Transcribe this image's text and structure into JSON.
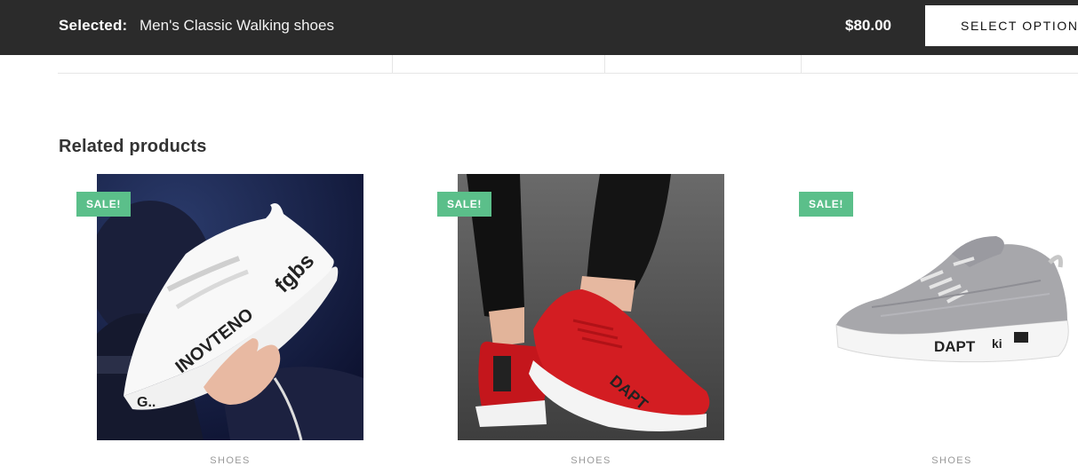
{
  "sticky_bar": {
    "selected_label": "Selected:",
    "product_name": "Men's Classic Walking shoes",
    "price": "$80.00",
    "button_label": "SELECT OPTIONS"
  },
  "related": {
    "title": "Related products",
    "items": [
      {
        "badge": "SALE!",
        "category": "SHOES",
        "image": "white-sneaker-photo"
      },
      {
        "badge": "SALE!",
        "category": "SHOES",
        "image": "red-sneaker-photo"
      },
      {
        "badge": "SALE!",
        "category": "SHOES",
        "image": "grey-sneaker-photo"
      }
    ]
  },
  "colors": {
    "bar_bg": "#2b2b2b",
    "badge_bg": "#5bbf8a"
  }
}
